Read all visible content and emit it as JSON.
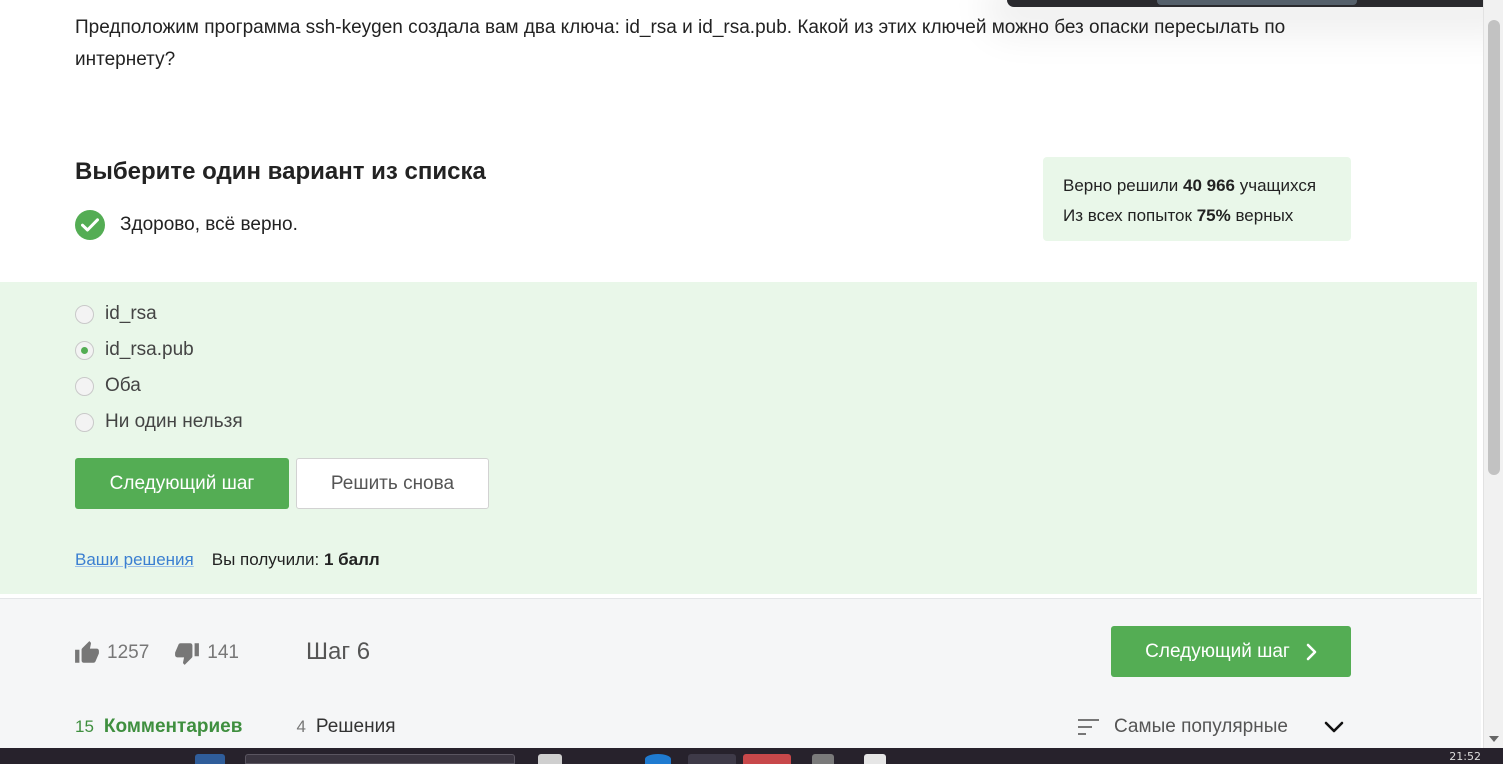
{
  "question": {
    "text": "Предположим программа ssh-keygen создала вам два ключа: id_rsa и id_rsa.pub. Какой из этих ключей можно без опаски пересылать по интернету?"
  },
  "quiz": {
    "title": "Выберите один вариант из списка",
    "status_text": "Здорово, всё верно.",
    "stats": {
      "solved_prefix": "Верно решили",
      "solved_count": "40 966",
      "solved_suffix": "учащихся",
      "attempts_prefix": "Из всех попыток",
      "attempts_percent": "75%",
      "attempts_suffix": "верных"
    },
    "options": [
      {
        "label": "id_rsa",
        "selected": false
      },
      {
        "label": "id_rsa.pub",
        "selected": true
      },
      {
        "label": "Оба",
        "selected": false
      },
      {
        "label": "Ни один нельзя",
        "selected": false
      }
    ],
    "next_button": "Следующий шаг",
    "retry_button": "Решить снова",
    "solutions_link": "Ваши решения",
    "score_prefix": "Вы получили:",
    "score_value": "1 балл"
  },
  "footer": {
    "likes": "1257",
    "dislikes": "141",
    "step_label": "Шаг 6",
    "next_button": "Следующий шаг",
    "tabs": [
      {
        "count": "15",
        "label": "Комментариев",
        "active": true
      },
      {
        "count": "4",
        "label": "Решения",
        "active": false
      }
    ],
    "sort_label": "Самые популярные"
  },
  "taskbar": {
    "clock": "21:52"
  },
  "colors": {
    "accent_green": "#54ad54",
    "success_bg": "#e9f7e9",
    "link_blue": "#3b7fd1"
  }
}
